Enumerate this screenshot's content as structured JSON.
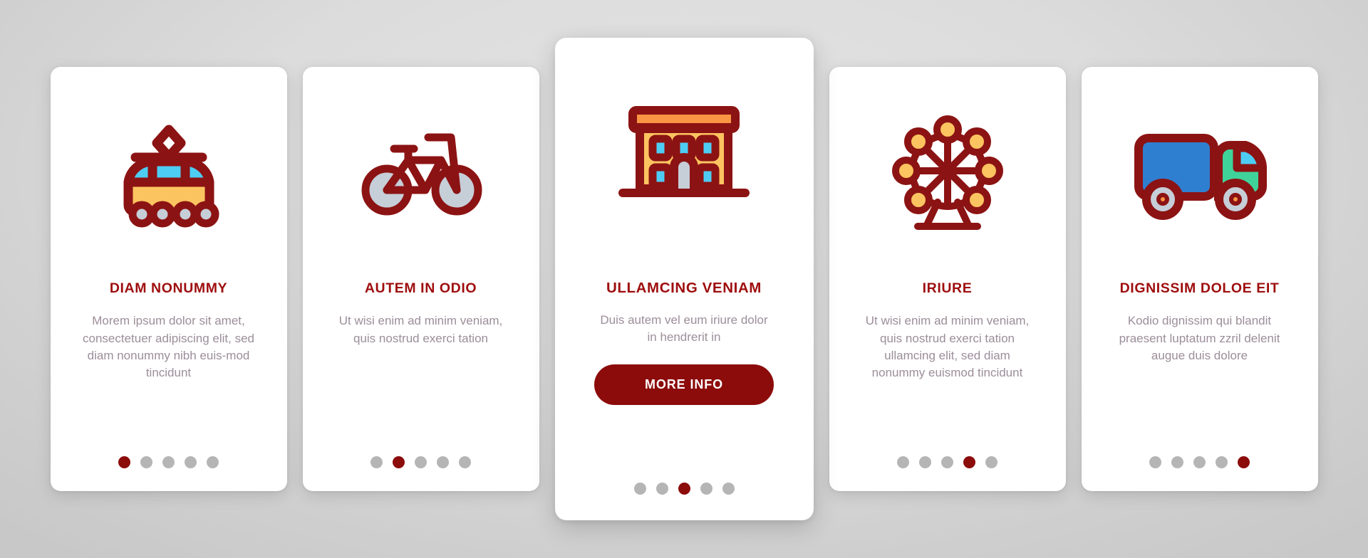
{
  "theme": {
    "accent": "#8c0b0b",
    "title_color": "#9e0d0d",
    "body_text_color": "#9c8e99",
    "card_bg": "#ffffff",
    "page_bg": "#dcdcdc",
    "dot_inactive": "#b5b5b5",
    "icon_stroke": "#8c1313",
    "icon_yellow": "#fcc460",
    "icon_orange": "#f99543",
    "icon_cyan": "#4ecdf4",
    "icon_grey": "#c6ced8",
    "icon_blue": "#2f7fd0",
    "icon_green": "#3fd39a"
  },
  "cards": [
    {
      "icon": "tram-icon",
      "title": "DIAM NONUMMY",
      "description": "Morem ipsum dolor sit amet, consectetuer adipiscing elit, sed diam nonummy nibh euis-mod tincidunt",
      "dots": {
        "count": 5,
        "active_index": 0
      },
      "featured": false,
      "button": null
    },
    {
      "icon": "bicycle-icon",
      "title": "AUTEM IN ODIO",
      "description": "Ut wisi enim ad minim veniam, quis nostrud exerci tation",
      "dots": {
        "count": 5,
        "active_index": 1
      },
      "featured": false,
      "button": null
    },
    {
      "icon": "building-icon",
      "title": "ULLAMCING VENIAM",
      "description": "Duis autem vel eum iriure dolor in hendrerit in",
      "dots": {
        "count": 5,
        "active_index": 2
      },
      "featured": true,
      "button": "MORE INFO"
    },
    {
      "icon": "ferris-wheel-icon",
      "title": "IRIURE",
      "description": "Ut wisi enim ad minim veniam, quis nostrud exerci tation ullamcing elit, sed diam nonummy euismod tincidunt",
      "dots": {
        "count": 5,
        "active_index": 3
      },
      "featured": false,
      "button": null
    },
    {
      "icon": "delivery-truck-icon",
      "title": "DIGNISSIM DOLOE EIT",
      "description": "Kodio dignissim qui blandit praesent luptatum zzril delenit augue duis dolore",
      "dots": {
        "count": 5,
        "active_index": 4
      },
      "featured": false,
      "button": null
    }
  ]
}
